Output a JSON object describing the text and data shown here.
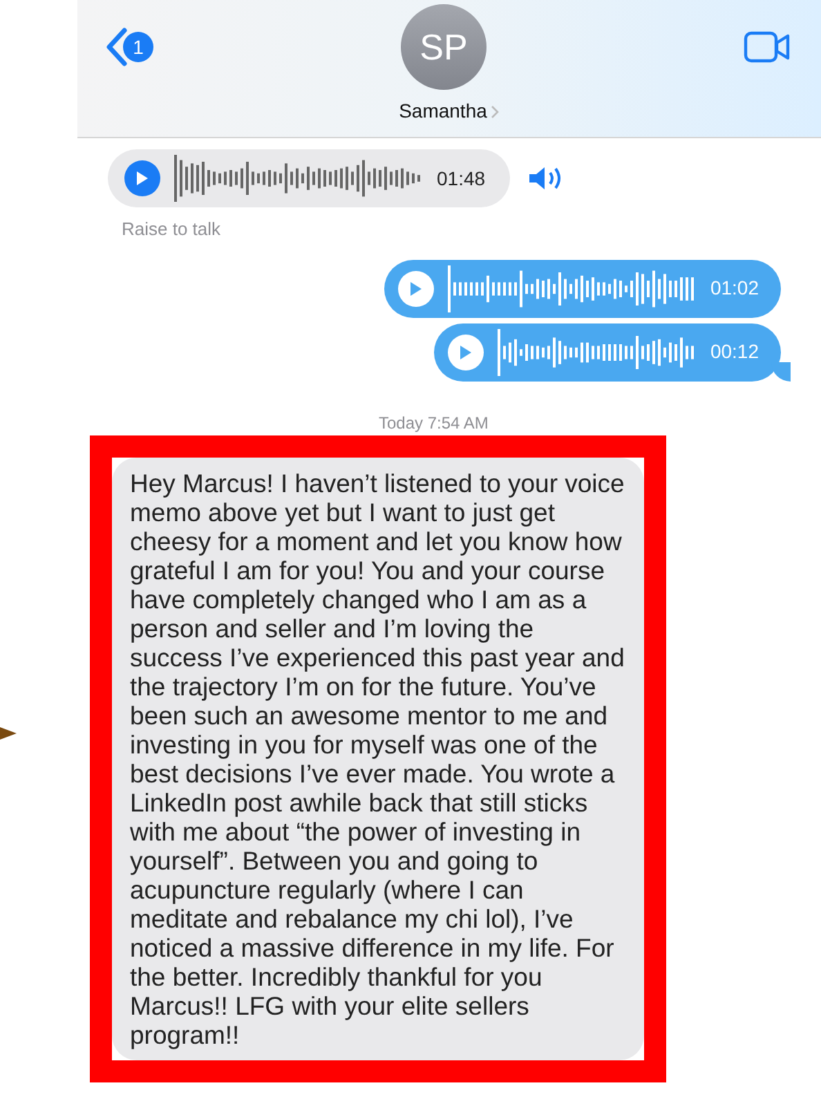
{
  "header": {
    "back_badge": "1",
    "avatar_initials": "SP",
    "contact_name": "Samantha"
  },
  "messages": [
    {
      "kind": "incoming_audio",
      "duration": "01:48",
      "note": "Raise to talk"
    },
    {
      "kind": "outgoing_audio",
      "duration": "01:02"
    },
    {
      "kind": "outgoing_audio",
      "duration": "00:12"
    },
    {
      "kind": "timestamp",
      "text": "Today 7:54 AM"
    },
    {
      "kind": "incoming_text",
      "highlighted": true,
      "text": "Hey Marcus! I haven’t listened to your voice memo above yet but I want to just get cheesy for a moment and let you know how grateful I am for you! You and your course have completely changed who I am as a person and seller and I’m loving the success I’ve experienced this past year and the trajectory I’m on for the future. You’ve been such an awesome mentor to me and investing in you for myself was one of the best decisions I’ve ever made. You wrote a LinkedIn post awhile back that still sticks with me about “the power of investing in yourself”. Between you and going to acupuncture regularly (where I can meditate and rebalance my chi lol), I’ve noticed a massive difference in my life. For the better. Incredibly thankful for you Marcus!! LFG with your elite sellers program!!"
    }
  ]
}
